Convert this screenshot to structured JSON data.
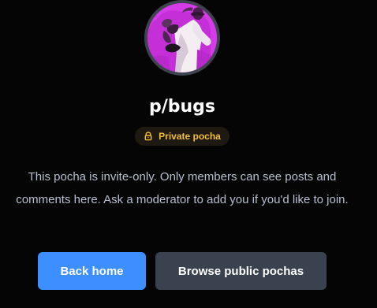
{
  "community": {
    "name": "p/bugs",
    "visibility_badge": "Private pocha",
    "visibility_icon": "lock-icon",
    "message": "This pocha is invite-only. Only members can see posts and comments here. Ask a moderator to add you if you'd like to join."
  },
  "actions": {
    "back_home_label": "Back home",
    "browse_public_label": "Browse public pochas"
  },
  "colors": {
    "background": "#050505",
    "accent": "#3d8fff",
    "badge_text": "#f4bd32",
    "avatar_tint": "#d53be6"
  }
}
